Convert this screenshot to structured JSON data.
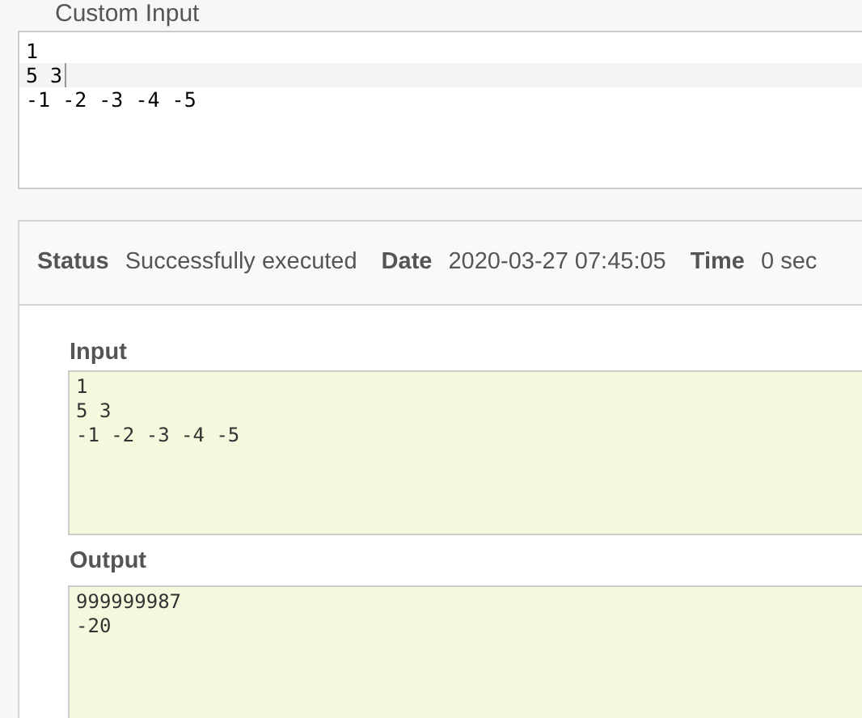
{
  "custom_input": {
    "label": "Custom Input",
    "lines": [
      {
        "text": "1",
        "current": false
      },
      {
        "text": "5 3",
        "current": true
      },
      {
        "text": "-1 -2 -3 -4 -5",
        "current": false
      }
    ]
  },
  "result": {
    "status_items": [
      {
        "label": "Status",
        "value": "Successfully executed"
      },
      {
        "label": "Date",
        "value": "2020-03-27 07:45:05"
      },
      {
        "label": "Time",
        "value": "0 sec"
      }
    ],
    "input": {
      "label": "Input",
      "text": "1\n5 3\n-1 -2 -3 -4 -5"
    },
    "output": {
      "label": "Output",
      "text": "999999987\n-20"
    }
  }
}
